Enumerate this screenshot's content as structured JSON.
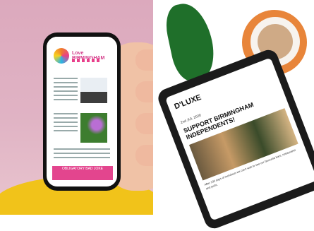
{
  "left_phone_newsletter": {
    "brand": "Love BIRMINGHAM",
    "joke_title": "OBLIGATORY BAD JOKE"
  },
  "right_tablet_magazine": {
    "logo": "D'LUXE",
    "date": "2nd JUL 2020",
    "headline": "SUPPORT BIRMINGHAM INDEPENDENTS!",
    "snippet": "After 100 days of lockdown we can't wait to see our favourite bars, restaurants and pubs."
  }
}
